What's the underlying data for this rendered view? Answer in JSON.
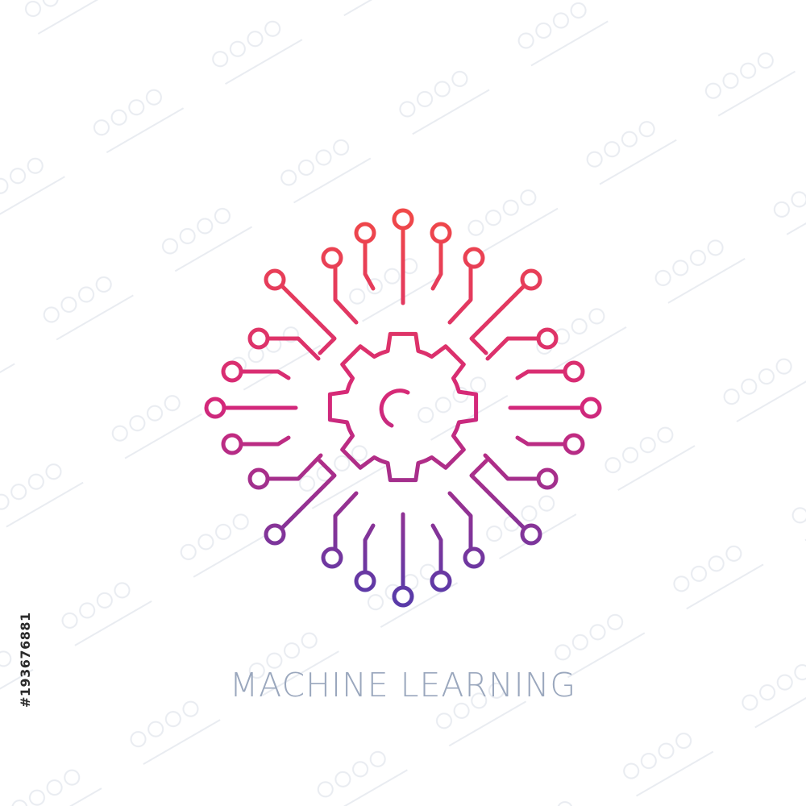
{
  "caption": {
    "text": "MACHINE LEARNING",
    "color": "#9aa7bd"
  },
  "stock_id": {
    "text": "#193676881"
  },
  "emblem": {
    "icon": "circuit-gear-icon",
    "gradient_top_color": "#f04848",
    "gradient_mid_color": "#d4287a",
    "gradient_bottom_color": "#5a3aa8"
  },
  "watermark": {
    "icon": "stock-watermark-pattern",
    "color": "#e9ecf1"
  }
}
